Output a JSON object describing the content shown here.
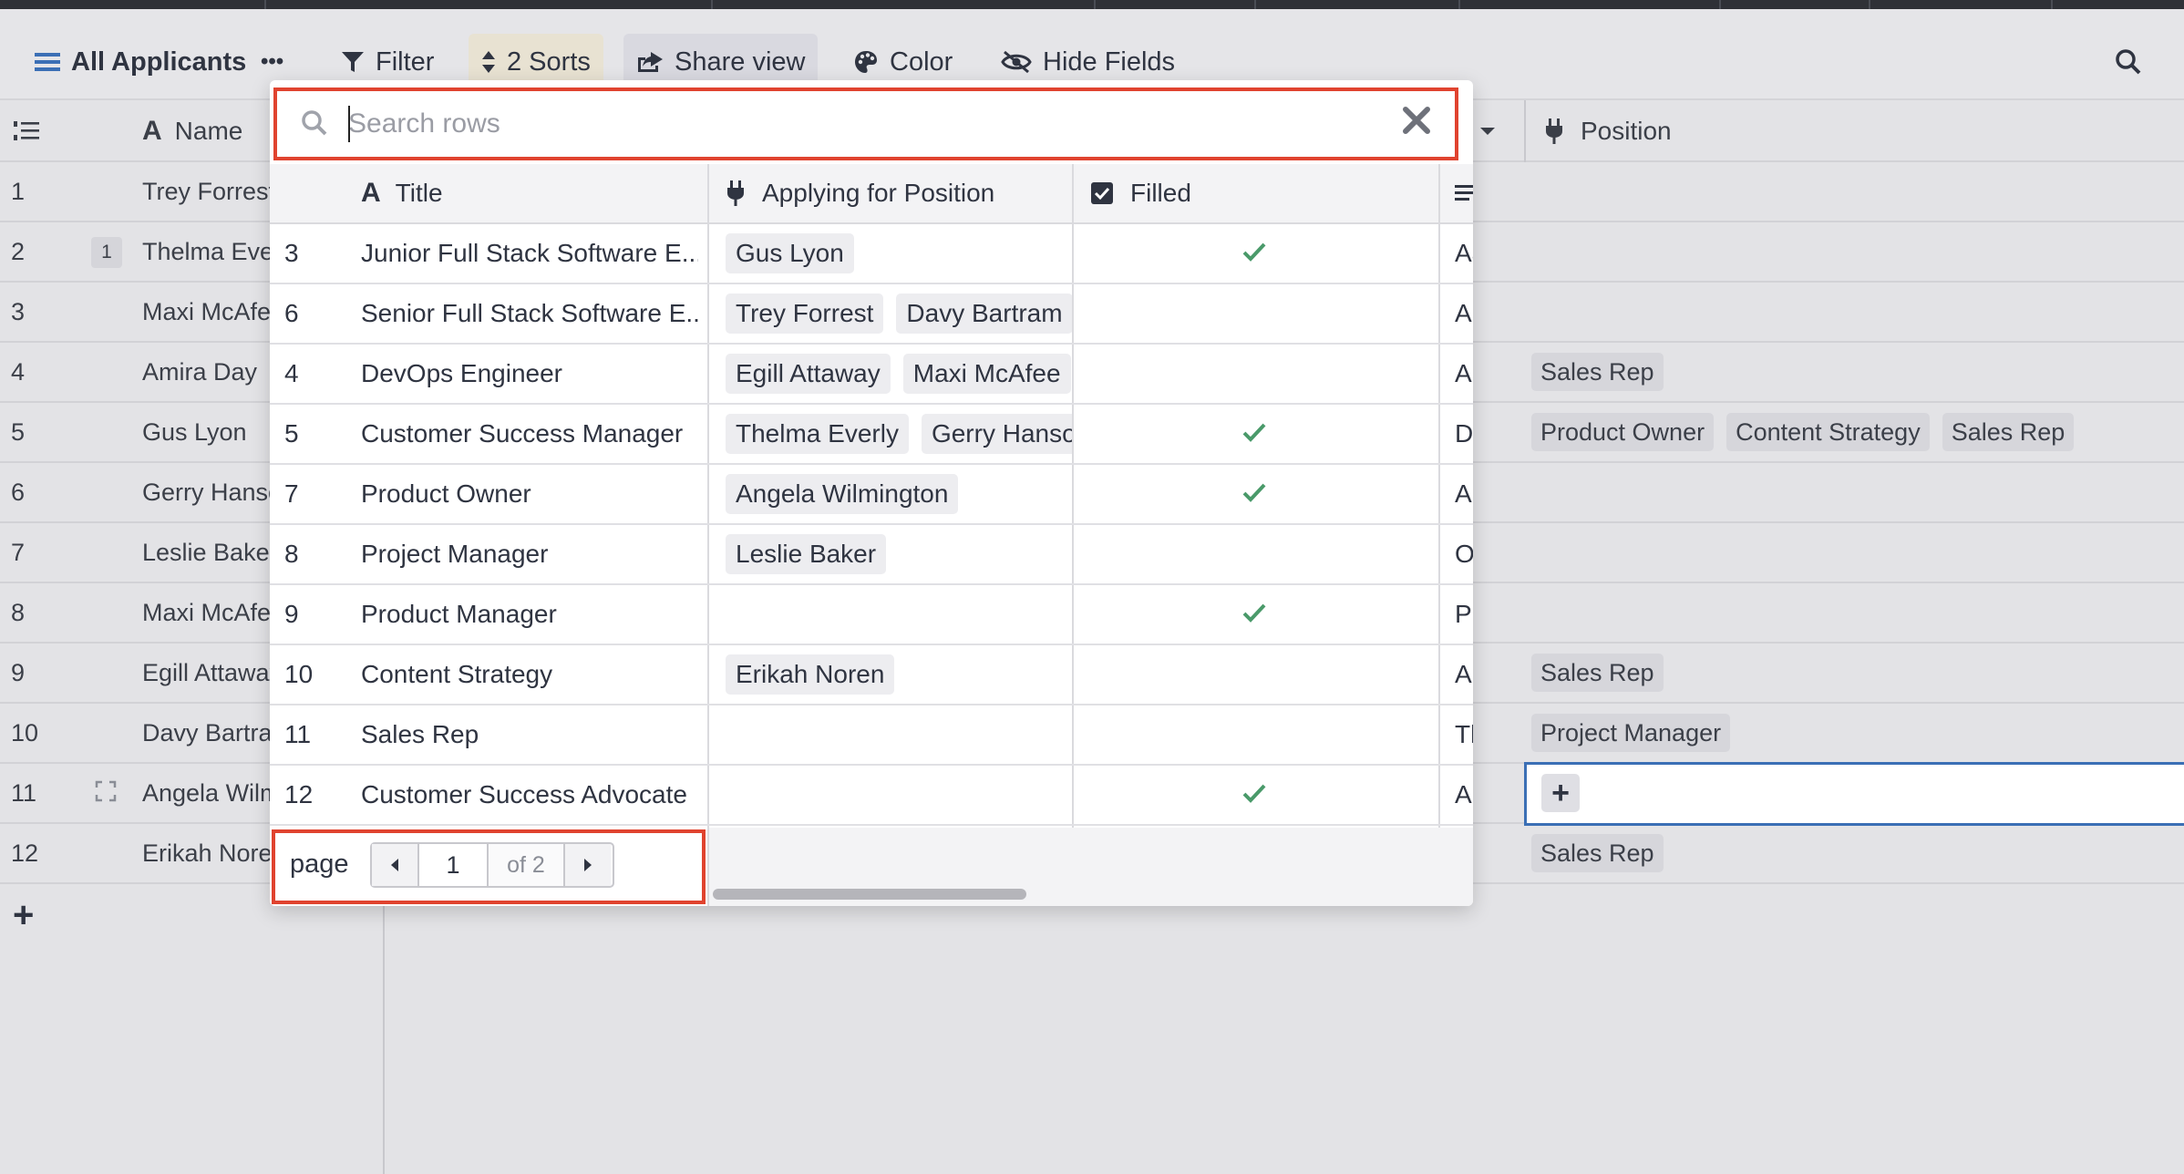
{
  "toolbar": {
    "view_name": "All Applicants",
    "more": "•••",
    "filter": "Filter",
    "sorts": "2 Sorts",
    "share": "Share view",
    "color": "Color",
    "hide_fields": "Hide Fields"
  },
  "grid": {
    "columns": {
      "name": "Name",
      "position": "Position"
    },
    "rows": [
      {
        "num": "1",
        "name": "Trey Forrest",
        "badge": "",
        "positions": []
      },
      {
        "num": "2",
        "name": "Thelma Everly",
        "badge": "1",
        "positions": []
      },
      {
        "num": "3",
        "name": "Maxi McAfee",
        "badge": "",
        "positions": []
      },
      {
        "num": "4",
        "name": "Amira Day",
        "badge": "",
        "positions": [
          "Sales Rep"
        ]
      },
      {
        "num": "5",
        "name": "Gus Lyon",
        "badge": "",
        "positions": [
          "Product Owner",
          "Content Strategy",
          "Sales Rep"
        ]
      },
      {
        "num": "6",
        "name": "Gerry Hanson",
        "badge": "",
        "positions": []
      },
      {
        "num": "7",
        "name": "Leslie Baker",
        "badge": "",
        "positions": []
      },
      {
        "num": "8",
        "name": "Maxi McAfee",
        "badge": "",
        "positions": []
      },
      {
        "num": "9",
        "name": "Egill Attaway",
        "badge": "",
        "positions": [
          "Sales Rep"
        ]
      },
      {
        "num": "10",
        "name": "Davy Bartram",
        "badge": "",
        "positions": [
          "Project Manager"
        ]
      },
      {
        "num": "11",
        "name": "Angela Wilmington",
        "badge": "",
        "positions": []
      },
      {
        "num": "12",
        "name": "Erikah Noren",
        "badge": "",
        "positions": [
          "Sales Rep"
        ]
      }
    ],
    "add_row": "+",
    "add_cell": "+"
  },
  "popup": {
    "search_placeholder": "Search rows",
    "columns": {
      "title": "Title",
      "applying": "Applying for Position",
      "filled": "Filled",
      "more": "..."
    },
    "rows": [
      {
        "id": "3",
        "title": "Junior Full Stack Software E...",
        "applicants": [
          "Gus Lyon"
        ],
        "filled": true,
        "desc": "Aa..."
      },
      {
        "id": "6",
        "title": "Senior Full Stack Software E...",
        "applicants": [
          "Trey Forrest",
          "Davy Bartram"
        ],
        "filled": false,
        "desc": "A"
      },
      {
        "id": "4",
        "title": "DevOps Engineer",
        "applicants": [
          "Egill Attaway",
          "Maxi McAfee"
        ],
        "filled": false,
        "desc": "A"
      },
      {
        "id": "5",
        "title": "Customer Success Manager",
        "applicants": [
          "Thelma Everly",
          "Gerry Hanson"
        ],
        "filled": true,
        "desc": "D..."
      },
      {
        "id": "7",
        "title": "Product Owner",
        "applicants": [
          "Angela Wilmington"
        ],
        "filled": true,
        "desc": "A"
      },
      {
        "id": "8",
        "title": "Project Manager",
        "applicants": [
          "Leslie Baker"
        ],
        "filled": false,
        "desc": "O"
      },
      {
        "id": "9",
        "title": "Product Manager",
        "applicants": [],
        "filled": true,
        "desc": "P"
      },
      {
        "id": "10",
        "title": "Content Strategy",
        "applicants": [
          "Erikah Noren"
        ],
        "filled": false,
        "desc": "A"
      },
      {
        "id": "11",
        "title": "Sales Rep",
        "applicants": [],
        "filled": false,
        "desc": "Tl"
      },
      {
        "id": "12",
        "title": "Customer Success Advocate",
        "applicants": [],
        "filled": true,
        "desc": "A"
      }
    ],
    "pager": {
      "label": "page",
      "current": "1",
      "of": "of 2"
    }
  },
  "colors": {
    "highlight": "#e0432f",
    "check": "#4a9a6a",
    "selection": "#3b6fb5"
  }
}
